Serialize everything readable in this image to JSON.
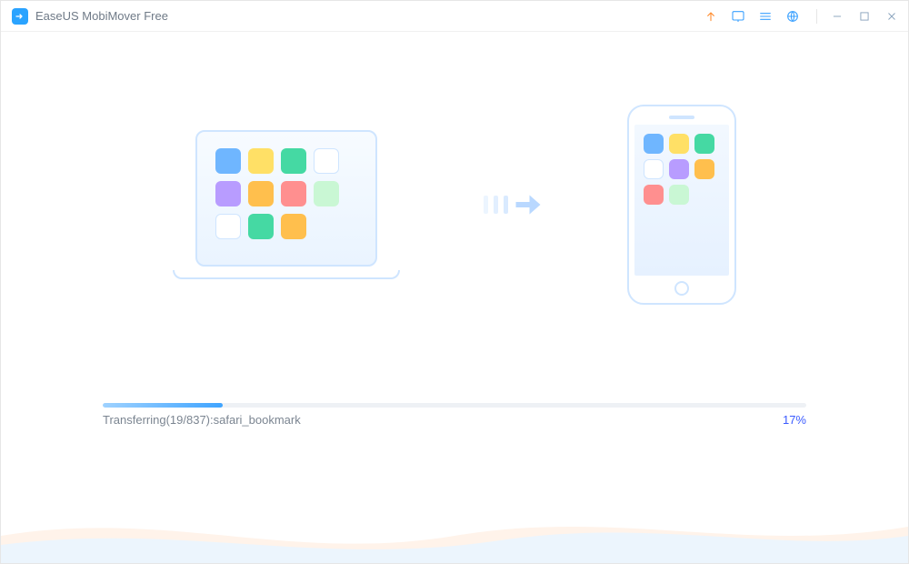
{
  "app": {
    "title": "EaseUS MobiMover Free"
  },
  "titlebar_icons": {
    "upgrade": "upgrade-icon",
    "feedback": "feedback-icon",
    "menu": "menu-icon",
    "language": "globe-icon"
  },
  "transfer": {
    "status_prefix": "Transferring",
    "current_index": 19,
    "total_items": 837,
    "current_item": "safari_bookmark",
    "status_text": "Transferring(19/837):safari_bookmark",
    "percent_value": 17,
    "percent_label": "17%"
  },
  "colors": {
    "accent": "#3fa4ff",
    "link": "#3b5bff",
    "tile_blue": "#6fb6ff",
    "tile_yellow": "#ffe066",
    "tile_green": "#45d9a3",
    "tile_white": "#ffffff",
    "tile_purple": "#b89cff",
    "tile_orange": "#ffbf4d",
    "tile_red": "#ff8f8f",
    "tile_lightgreen": "#c9f7d4"
  },
  "source_tiles": [
    "tile_blue",
    "tile_yellow",
    "tile_green",
    "tile_white",
    "tile_purple",
    "tile_orange",
    "tile_red",
    "tile_lightgreen",
    "tile_white",
    "tile_green",
    "tile_orange"
  ],
  "target_tiles": [
    "tile_blue",
    "tile_yellow",
    "tile_green",
    "tile_white",
    "tile_purple",
    "tile_orange",
    "tile_red",
    "tile_lightgreen"
  ]
}
